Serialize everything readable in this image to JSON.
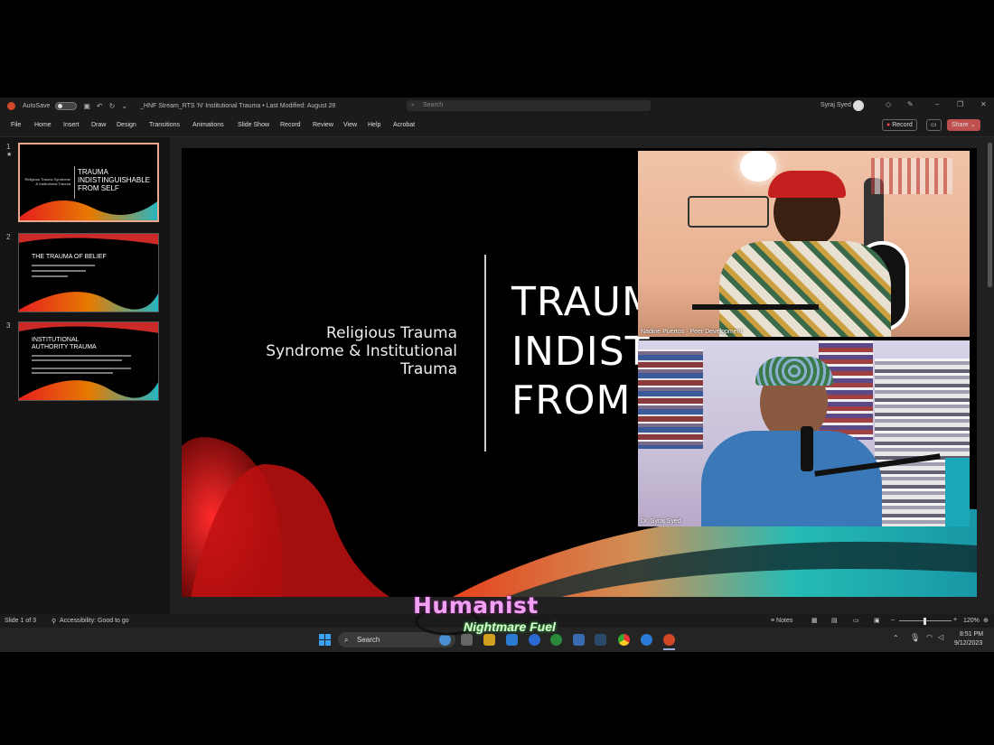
{
  "titlebar": {
    "autosave_label": "AutoSave",
    "document_title": "_HNF Stream_RTS 'N' Institutional Trauma • Last Modified: August 28",
    "search_placeholder": "Search",
    "user_name": "Syraj Syed"
  },
  "ribbon": {
    "tabs": [
      "File",
      "Home",
      "Insert",
      "Draw",
      "Design",
      "Transitions",
      "Animations",
      "Slide Show",
      "Record",
      "Review",
      "View",
      "Help",
      "Acrobat"
    ],
    "record_label": "Record",
    "share_label": "Share"
  },
  "thumbnails": [
    {
      "number": "1",
      "title": "TRAUMA INDISTINGUISHABLE FROM SELF",
      "subtitle": "Religious Trauma Syndrome & Institutional Trauma"
    },
    {
      "number": "2",
      "title": "THE TRAUMA OF BELIEF"
    },
    {
      "number": "3",
      "title": "INSTITUTIONAL AUTHORITY TRAUMA"
    }
  ],
  "slide": {
    "subtitle_line1": "Religious Trauma",
    "subtitle_line2": "Syndrome & Institutional",
    "subtitle_line3": "Trauma",
    "title_line1": "TRAUM",
    "title_line2": "INDIST",
    "title_line3": "FROM"
  },
  "videos": [
    {
      "label": "Nadine Puertos · Peer Development"
    },
    {
      "label": "Dr. Syraj Syed"
    }
  ],
  "status": {
    "slide_count": "Slide 1 of 3",
    "accessibility": "Accessibility: Good to go",
    "notes": "Notes",
    "zoom": "120%"
  },
  "overlay": {
    "brand_line1": "Humanist",
    "brand_line2": "Nightmare Fuel"
  },
  "taskbar": {
    "search_label": "Search",
    "time": "8:51 PM",
    "date": "9/12/2023"
  }
}
